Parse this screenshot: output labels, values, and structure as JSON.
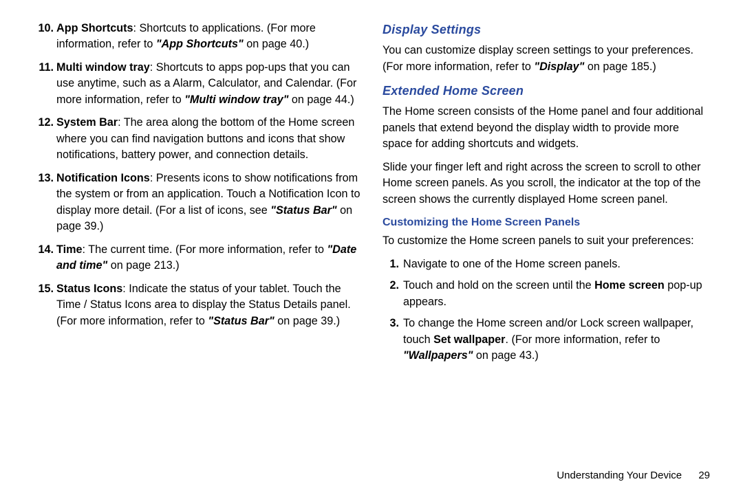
{
  "left": {
    "items": [
      {
        "n": "10.",
        "term": "App Shortcuts",
        "body": ": Shortcuts to applications. (For more information, refer to ",
        "ref": "\"App Shortcuts\"",
        "after": " on page 40.)"
      },
      {
        "n": "11.",
        "term": "Multi window tray",
        "body": ": Shortcuts to apps pop-ups that you can use anytime, such as a Alarm, Calculator, and Calendar. (For more information, refer to ",
        "ref": "\"Multi window tray\"",
        "after": " on page 44.)"
      },
      {
        "n": "12.",
        "term": "System Bar",
        "body": ": The area along the bottom of the Home screen where you can find navigation buttons and icons that show notifications, battery power, and connection details.",
        "ref": "",
        "after": ""
      },
      {
        "n": "13.",
        "term": "Notification Icons",
        "body": ": Presents icons to show notifications from the system or from an application. Touch a Notification Icon to display more detail. (For a list of icons, see ",
        "ref": "\"Status Bar\"",
        "after": " on page 39.)"
      },
      {
        "n": "14.",
        "term": "Time",
        "body": ": The current time. (For more information, refer to ",
        "ref": "\"Date and time\"",
        "after": " on page 213.)"
      },
      {
        "n": "15.",
        "term": "Status Icons",
        "body": ": Indicate the status of your tablet. Touch the Time / Status Icons area to display the Status Details panel. (For more information, refer to ",
        "ref": "\"Status Bar\"",
        "after": " on page 39.)"
      }
    ]
  },
  "right": {
    "h_display": "Display Settings",
    "display_body_pre": "You can customize display screen settings to your preferences. (For more information, refer to ",
    "display_ref": "\"Display\"",
    "display_body_post": " on page 185.)",
    "h_extended": "Extended Home Screen",
    "ext_p1": "The Home screen consists of the Home panel and four additional panels that extend beyond the display width to provide more space for adding shortcuts and widgets.",
    "ext_p2": "Slide your finger left and right across the screen to scroll to other Home screen panels. As you scroll, the indicator at the top of the screen shows the currently displayed Home screen panel.",
    "h_custom": "Customizing the Home Screen Panels",
    "custom_intro": "To customize the Home screen panels to suit your preferences:",
    "steps": [
      {
        "n": "1.",
        "pre": "Navigate to one of the Home screen panels.",
        "bold": "",
        "post": ""
      },
      {
        "n": "2.",
        "pre": "Touch and hold on the screen until the ",
        "bold": "Home screen",
        "post": " pop-up appears."
      },
      {
        "n": "3.",
        "pre": "To change the Home screen and/or Lock screen wallpaper, touch ",
        "bold": "Set wallpaper",
        "post": ". (For more information, refer to ",
        "ref": "\"Wallpapers\"",
        "after": " on page 43.)"
      }
    ]
  },
  "footer": {
    "section": "Understanding Your Device",
    "page": "29"
  }
}
